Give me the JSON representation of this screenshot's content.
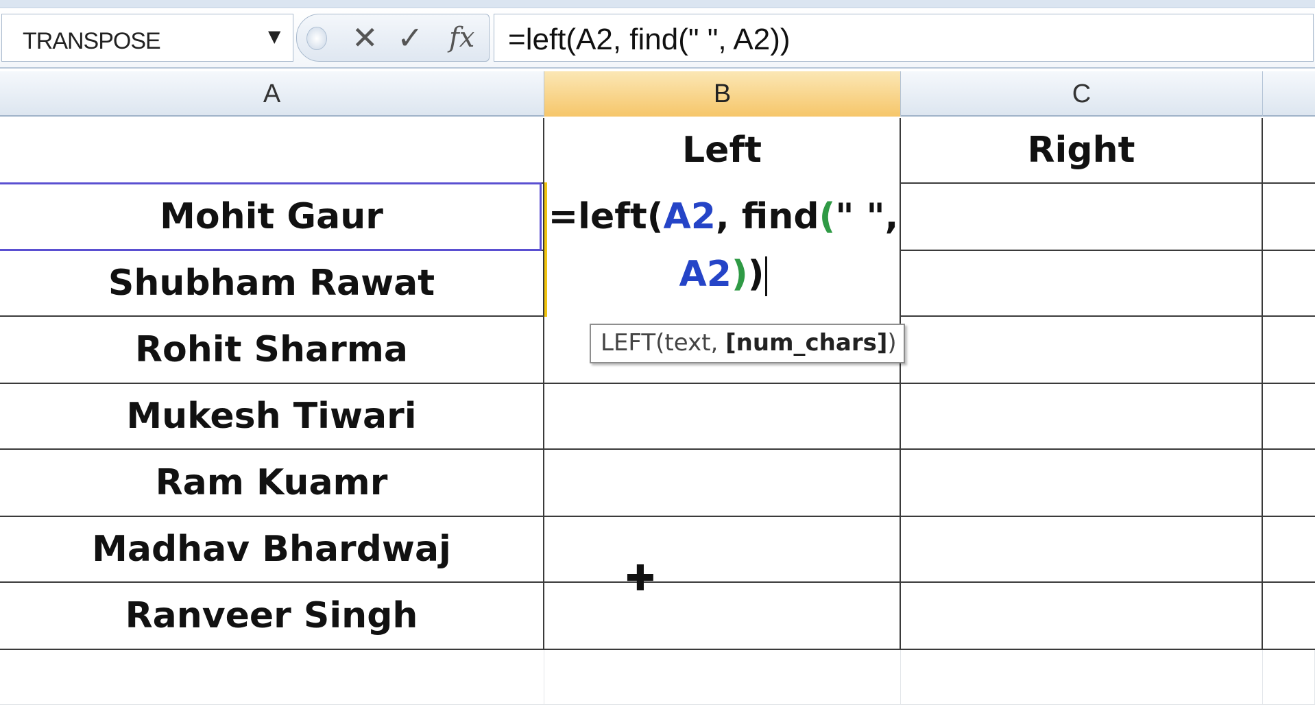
{
  "formula_bar": {
    "name_box": "TRANSPOSE",
    "name_box_dropdown_icon": "chevron-down-icon",
    "cancel_icon": "✕",
    "enter_icon": "✓",
    "function_icon": "fx",
    "formula": "=left(A2, find(\" \", A2))"
  },
  "columns": [
    {
      "label": "A"
    },
    {
      "label": "B"
    },
    {
      "label": "C"
    }
  ],
  "active_column": "B",
  "headers": {
    "b1": "Left",
    "c1": "Right"
  },
  "names": [
    "Mohit Gaur",
    "Shubham Rawat",
    "Rohit Sharma",
    "Mukesh Tiwari",
    "Ram Kuamr",
    "Madhav Bhardwaj",
    "Ranveer Singh"
  ],
  "editing_cell": {
    "line1_prefix": "=left(",
    "ref1": "A2",
    "mid": ", find",
    "open_paren": "(",
    "quote": "\" \",",
    "ref2": "A2",
    "close_inner": ")",
    "close_outer": ")"
  },
  "tooltip": {
    "fn": "LEFT(text, ",
    "arg": "[num_chars]",
    "close": ")"
  },
  "colors": {
    "active_header": "#f6c66a",
    "reference": "#2544c7",
    "paren": "#2f9a45",
    "selection_border": "#5a4fd1"
  }
}
